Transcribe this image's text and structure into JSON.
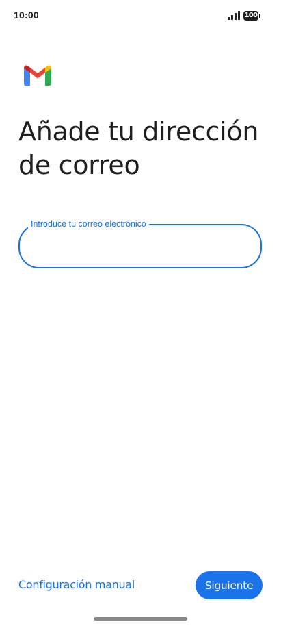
{
  "status_bar": {
    "time": "10:00",
    "battery_level": "100",
    "signal_icon": "signal-bars-icon",
    "battery_icon": "battery-icon"
  },
  "brand": {
    "logo_icon": "gmail-logo-icon",
    "colors": {
      "blue": "#4285f4",
      "red": "#ea4335",
      "yellow": "#fbbc04",
      "green": "#34a853",
      "dark_red": "#c5221f"
    }
  },
  "main": {
    "title": "Añade tu dirección de correo",
    "email_field": {
      "label": "Introduce tu correo electrónico",
      "value": "",
      "placeholder": ""
    }
  },
  "footer": {
    "manual_config_label": "Configuración manual",
    "next_label": "Siguiente"
  },
  "theme": {
    "accent": "#1a73e8",
    "text": "#1f1f1f",
    "background": "#ffffff"
  }
}
